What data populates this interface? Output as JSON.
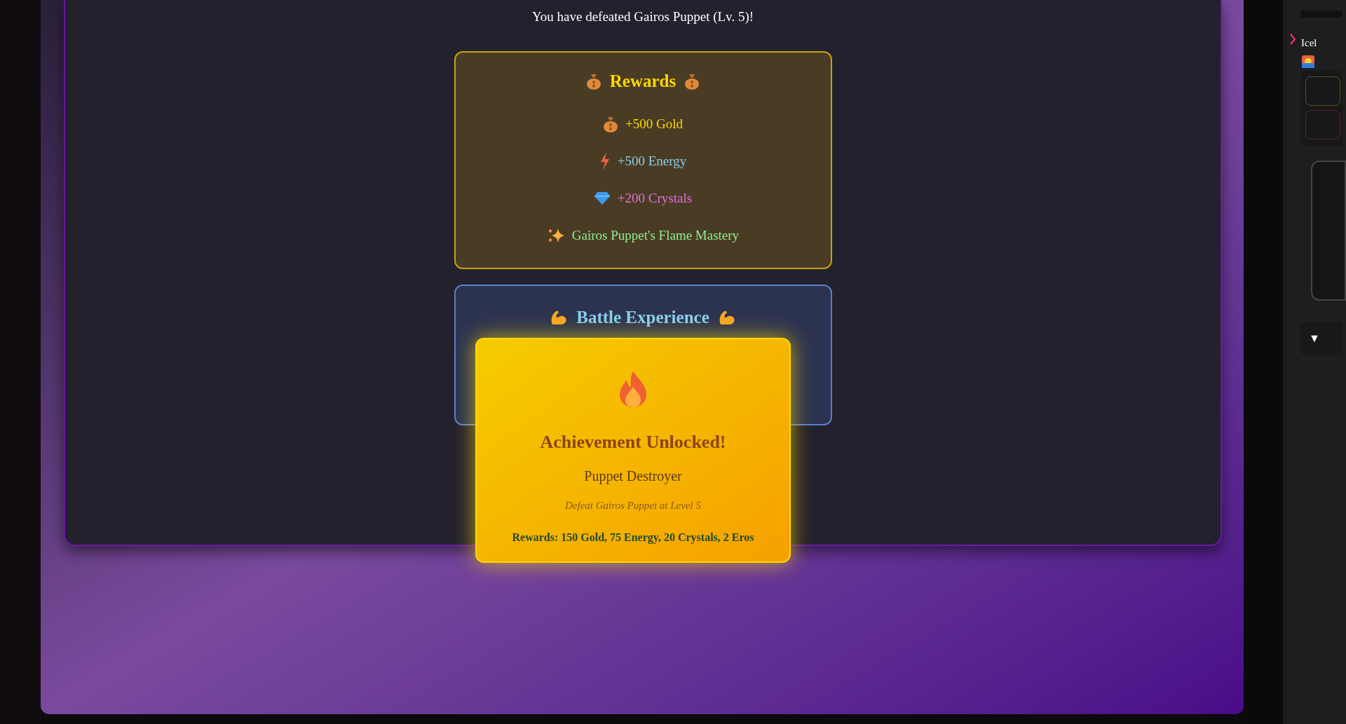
{
  "battle_result": {
    "message": "You have defeated Gairos Puppet (Lv. 5)!"
  },
  "rewards": {
    "title": "Rewards",
    "items": [
      {
        "kind": "gold",
        "text": "+500 Gold"
      },
      {
        "kind": "energy",
        "text": "+500 Energy"
      },
      {
        "kind": "crystals",
        "text": "+200 Crystals"
      },
      {
        "kind": "skill",
        "text": "Gairos Puppet's Flame Mastery"
      }
    ]
  },
  "battle_experience": {
    "title": "Battle Experience"
  },
  "achievement": {
    "heading": "Achievement Unlocked!",
    "name": "Puppet Destroyer",
    "description": "Defeat Gairos Puppet at Level 5",
    "rewards": "Rewards: 150 Gold, 75 Energy, 20 Crystals, 2 Eros"
  },
  "side_panel": {
    "title": "Icel",
    "dropdown": "▼"
  }
}
